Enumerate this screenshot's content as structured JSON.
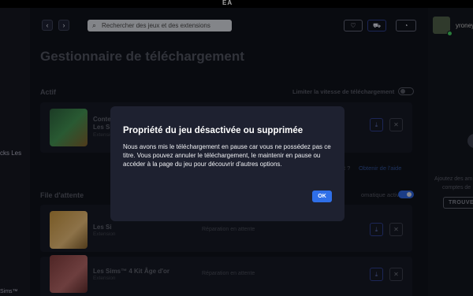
{
  "app": {
    "logo": "EA"
  },
  "search": {
    "placeholder": "Rechercher des jeux et des extensions"
  },
  "page": {
    "title": "Gestionnaire de téléchargement"
  },
  "active": {
    "label": "Actif",
    "limit_label": "Limiter la vitesse de téléchargement",
    "item": {
      "title_line1": "Conte",
      "title_line2": "Les Sim",
      "sub": "Extension"
    },
    "help_pre": "t ?",
    "help_link": "Obtenir de l'aide"
  },
  "queue": {
    "label": "File d'attente",
    "auto_label": "omatique activée",
    "items": [
      {
        "title": "Les Si",
        "sub": "Extension",
        "status": "Réparation en attente"
      },
      {
        "title": "Les Sims™ 4 Kit Âge d'or",
        "sub": "Extension",
        "status": "Réparation en attente"
      }
    ]
  },
  "right": {
    "username": "yroney",
    "add_text_1": "Ajoutez des am",
    "add_text_2": "comptes de",
    "find_button": "TROUVE"
  },
  "left": {
    "text_1": "cks Les",
    "text_2": "Sims™"
  },
  "modal": {
    "title": "Propriété du jeu désactivée ou supprimée",
    "body": "Nous avons mis le téléchargement en pause car vous ne possédez pas ce titre. Vous pouvez annuler le téléchargement, le maintenir en pause ou accéder à la page du jeu pour découvrir d'autres options.",
    "ok": "OK"
  },
  "colors": {
    "accent": "#2f6fe8",
    "online": "#3fbf5a"
  }
}
